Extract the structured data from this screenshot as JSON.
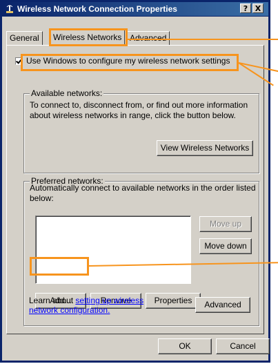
{
  "window": {
    "title": "Wireless Network Connection Properties",
    "help_label": "?",
    "close_label": "X"
  },
  "tabs": [
    {
      "label": "General"
    },
    {
      "label": "Wireless Networks"
    },
    {
      "label": "Advanced"
    }
  ],
  "use_windows_checkbox": {
    "label": "Use Windows to configure my wireless network settings",
    "checked": true
  },
  "available": {
    "legend": "Available networks:",
    "description": "To connect to, disconnect from, or find out more information about wireless networks in range, click the button below.",
    "view_button": "View Wireless Networks"
  },
  "preferred": {
    "legend": "Preferred networks:",
    "description": "Automatically connect to available networks in the order listed below:",
    "move_up": "Move up",
    "move_down": "Move down",
    "add": "Add...",
    "remove": "Remove",
    "properties": "Properties"
  },
  "learn": {
    "prefix": "Learn about ",
    "link": "setting up wireless network configuration.",
    "advanced_button": "Advanced"
  },
  "footer": {
    "ok": "OK",
    "cancel": "Cancel"
  },
  "colors": {
    "highlight": "#f7941d",
    "title_bar": "#0a246a",
    "face": "#d4d0c8"
  }
}
